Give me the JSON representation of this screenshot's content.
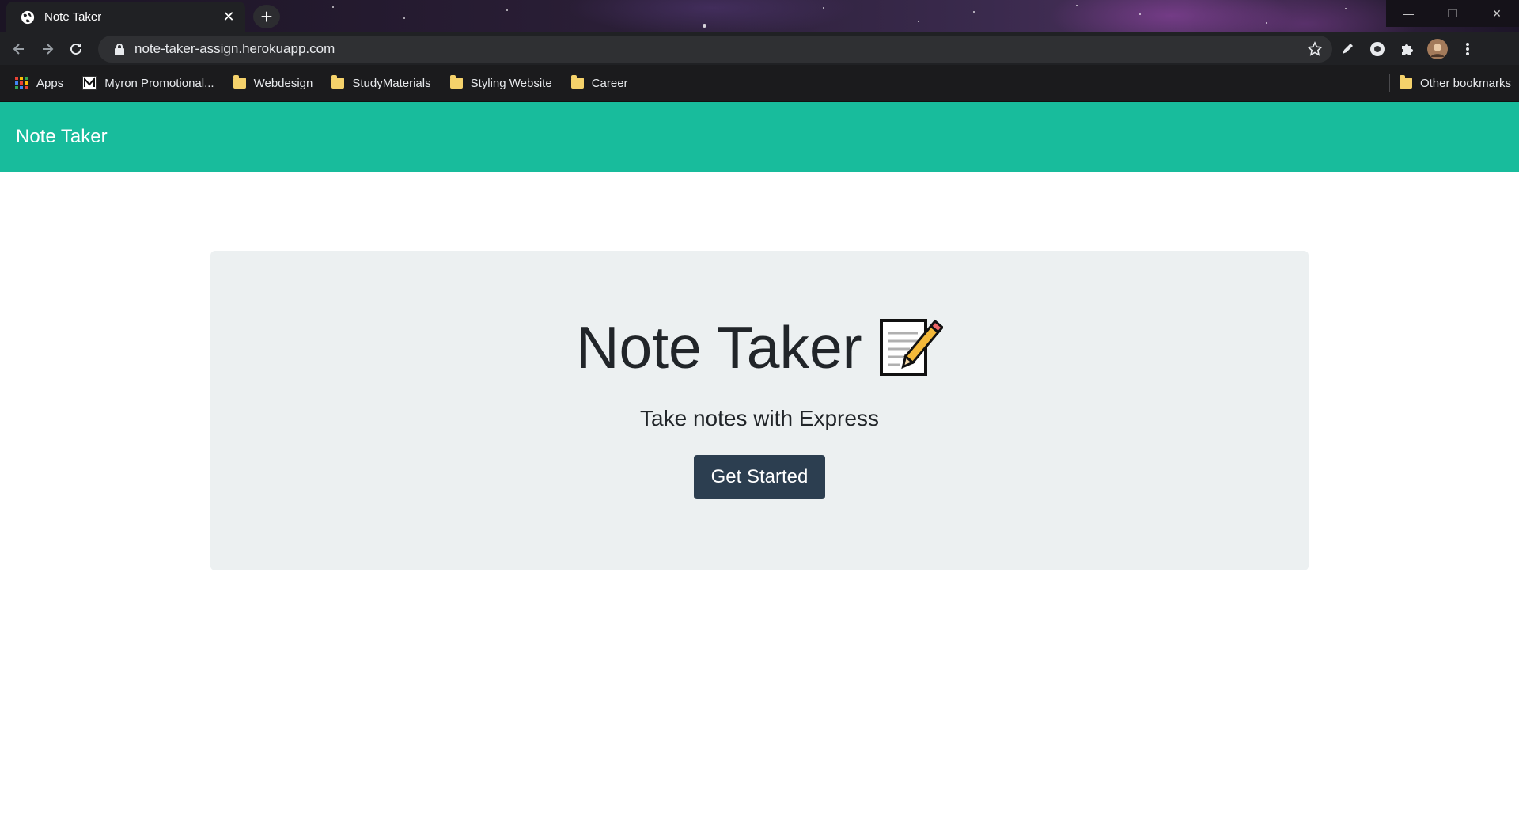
{
  "browser": {
    "tab_title": "Note Taker",
    "url": "note-taker-assign.herokuapp.com",
    "bookmarks": [
      {
        "label": "Apps",
        "icon": "apps-grid-icon"
      },
      {
        "label": "Myron Promotional...",
        "icon": "myron-m-icon"
      },
      {
        "label": "Webdesign",
        "icon": "folder-icon"
      },
      {
        "label": "StudyMaterials",
        "icon": "folder-icon"
      },
      {
        "label": "Styling Website",
        "icon": "folder-icon"
      },
      {
        "label": "Career",
        "icon": "folder-icon"
      }
    ],
    "other_bookmarks": "Other bookmarks"
  },
  "page": {
    "navbar_brand": "Note Taker",
    "heading": "Note Taker",
    "lead": "Take notes with Express",
    "button_label": "Get Started",
    "colors": {
      "navbar": "#18bc9c",
      "jumbotron": "#ecf0f1",
      "button": "#2c3e50"
    }
  }
}
